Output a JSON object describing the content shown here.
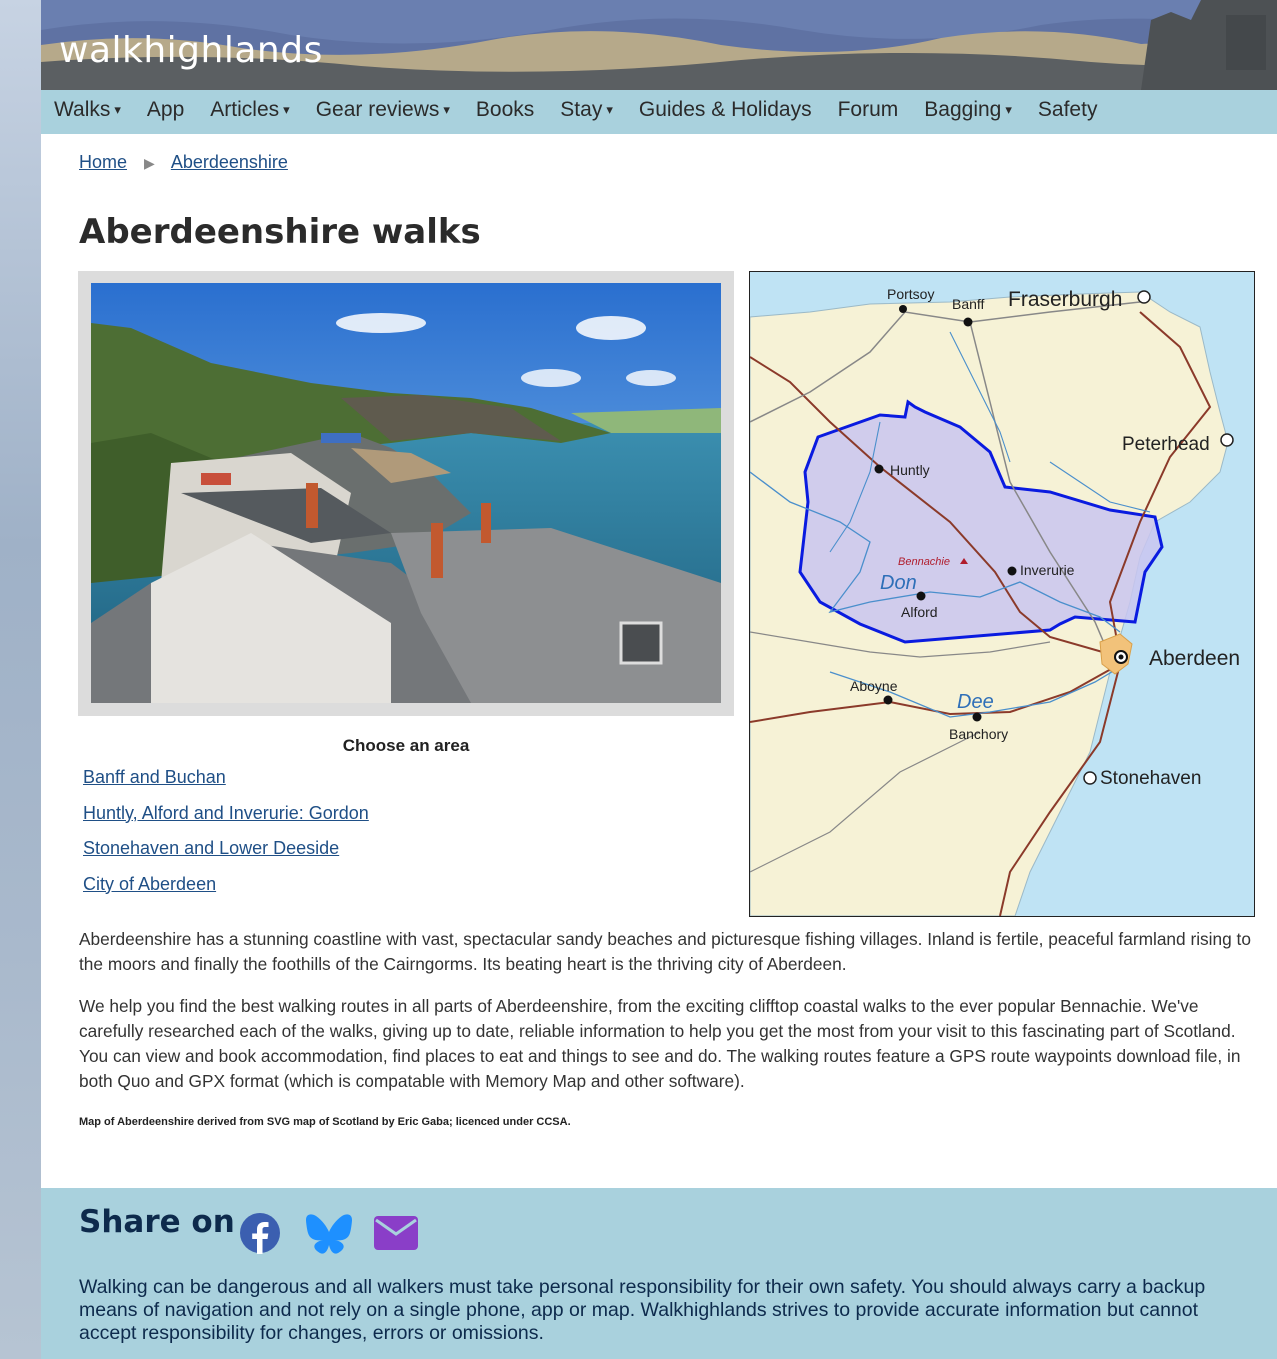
{
  "header": {
    "logo": "walkhighlands"
  },
  "nav": {
    "items": [
      {
        "label": "Walks",
        "dropdown": true
      },
      {
        "label": "App",
        "dropdown": false
      },
      {
        "label": "Articles",
        "dropdown": true
      },
      {
        "label": "Gear reviews",
        "dropdown": true
      },
      {
        "label": "Books",
        "dropdown": false
      },
      {
        "label": "Stay",
        "dropdown": true
      },
      {
        "label": "Guides & Holidays",
        "dropdown": false
      },
      {
        "label": "Forum",
        "dropdown": false
      },
      {
        "label": "Bagging",
        "dropdown": true
      },
      {
        "label": "Safety",
        "dropdown": false
      }
    ],
    "caret": "▾"
  },
  "breadcrumb": {
    "home": "Home",
    "separator": "▶",
    "current": "Aberdeenshire"
  },
  "page_title": "Aberdeenshire walks",
  "areas": {
    "heading": "Choose an area",
    "items": [
      "Banff and Buchan",
      "Huntly, Alford and Inverurie: Gordon",
      "Stonehaven and Lower Deeside",
      "City of Aberdeen"
    ]
  },
  "map": {
    "labels": {
      "portsoy": "Portsoy",
      "banff": "Banff",
      "fraserburgh": "Fraserburgh",
      "peterhead": "Peterhead",
      "huntly": "Huntly",
      "bennachie": "Bennachie",
      "inverurie": "Inverurie",
      "don": "Don",
      "alford": "Alford",
      "aberdeen": "Aberdeen",
      "aboyne": "Aboyne",
      "dee": "Dee",
      "banchory": "Banchory",
      "stonehaven": "Stonehaven"
    },
    "colors": {
      "sea": "#bfe3f4",
      "land": "#f6f2d6",
      "highlight": "#c9c6f0",
      "highlight_border": "#0a1be0"
    }
  },
  "intro": [
    "Aberdeenshire has a stunning coastline with vast, spectacular sandy beaches and picturesque fishing villages. Inland is fertile, peaceful farmland rising to the moors and finally the foothills of the Cairngorms. Its beating heart is the thriving city of Aberdeen.",
    "We help you find the best walking routes in all parts of Aberdeenshire, from the exciting clifftop coastal walks to the ever popular Bennachie. We've carefully researched each of the walks, giving up to date, reliable information to help you get the most from your visit to this fascinating part of Scotland. You can view and book accommodation, find places to eat and things to see and do. The walking routes feature a GPS route waypoints download file, in both Quo and GPX format (which is compatable with Memory Map and other software)."
  ],
  "credit": "Map of Aberdeenshire derived from SVG map of Scotland by Eric Gaba; licenced under CCSA.",
  "footer": {
    "share_title": "Share on",
    "icons": [
      "facebook-icon",
      "bluesky-icon",
      "email-icon"
    ],
    "icon_colors": {
      "facebook": "#3b5fb0",
      "bluesky": "#1e90ff",
      "email": "#8a3ec8"
    },
    "disclaimer": "Walking can be dangerous and all walkers must take personal responsibility for their own safety. You should always carry a backup means of navigation and not rely on a single phone, app or map. Walkhighlands strives to provide accurate information but cannot accept responsibility for changes, errors or omissions."
  }
}
